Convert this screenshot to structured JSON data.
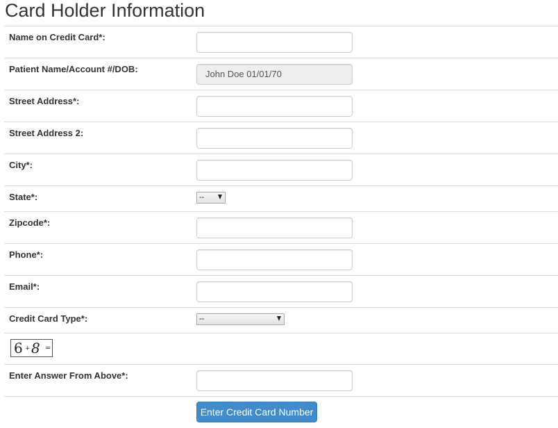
{
  "page": {
    "title": "Card Holder Information"
  },
  "fields": [
    {
      "label": "Name on Credit Card*:",
      "type": "text",
      "value": ""
    },
    {
      "label": "Patient Name/Account #/DOB:",
      "type": "readonly",
      "value": "John Doe 01/01/70"
    },
    {
      "label": "Street Address*:",
      "type": "text",
      "value": ""
    },
    {
      "label": "Street Address 2:",
      "type": "text",
      "value": ""
    },
    {
      "label": "City*:",
      "type": "text",
      "value": ""
    },
    {
      "label": "State*:",
      "type": "select",
      "value": "--"
    },
    {
      "label": "Zipcode*:",
      "type": "text",
      "value": ""
    },
    {
      "label": "Phone*:",
      "type": "text",
      "value": ""
    },
    {
      "label": "Email*:",
      "type": "text",
      "value": ""
    },
    {
      "label": "Credit Card Type*:",
      "type": "select",
      "value": "--"
    }
  ],
  "captcha": {
    "a": "6",
    "op": "+",
    "b": "8",
    "eq": "="
  },
  "answer": {
    "label": "Enter Answer From Above*:",
    "value": ""
  },
  "submit": {
    "label": "Enter Credit Card Number",
    "color": "#428bca"
  }
}
